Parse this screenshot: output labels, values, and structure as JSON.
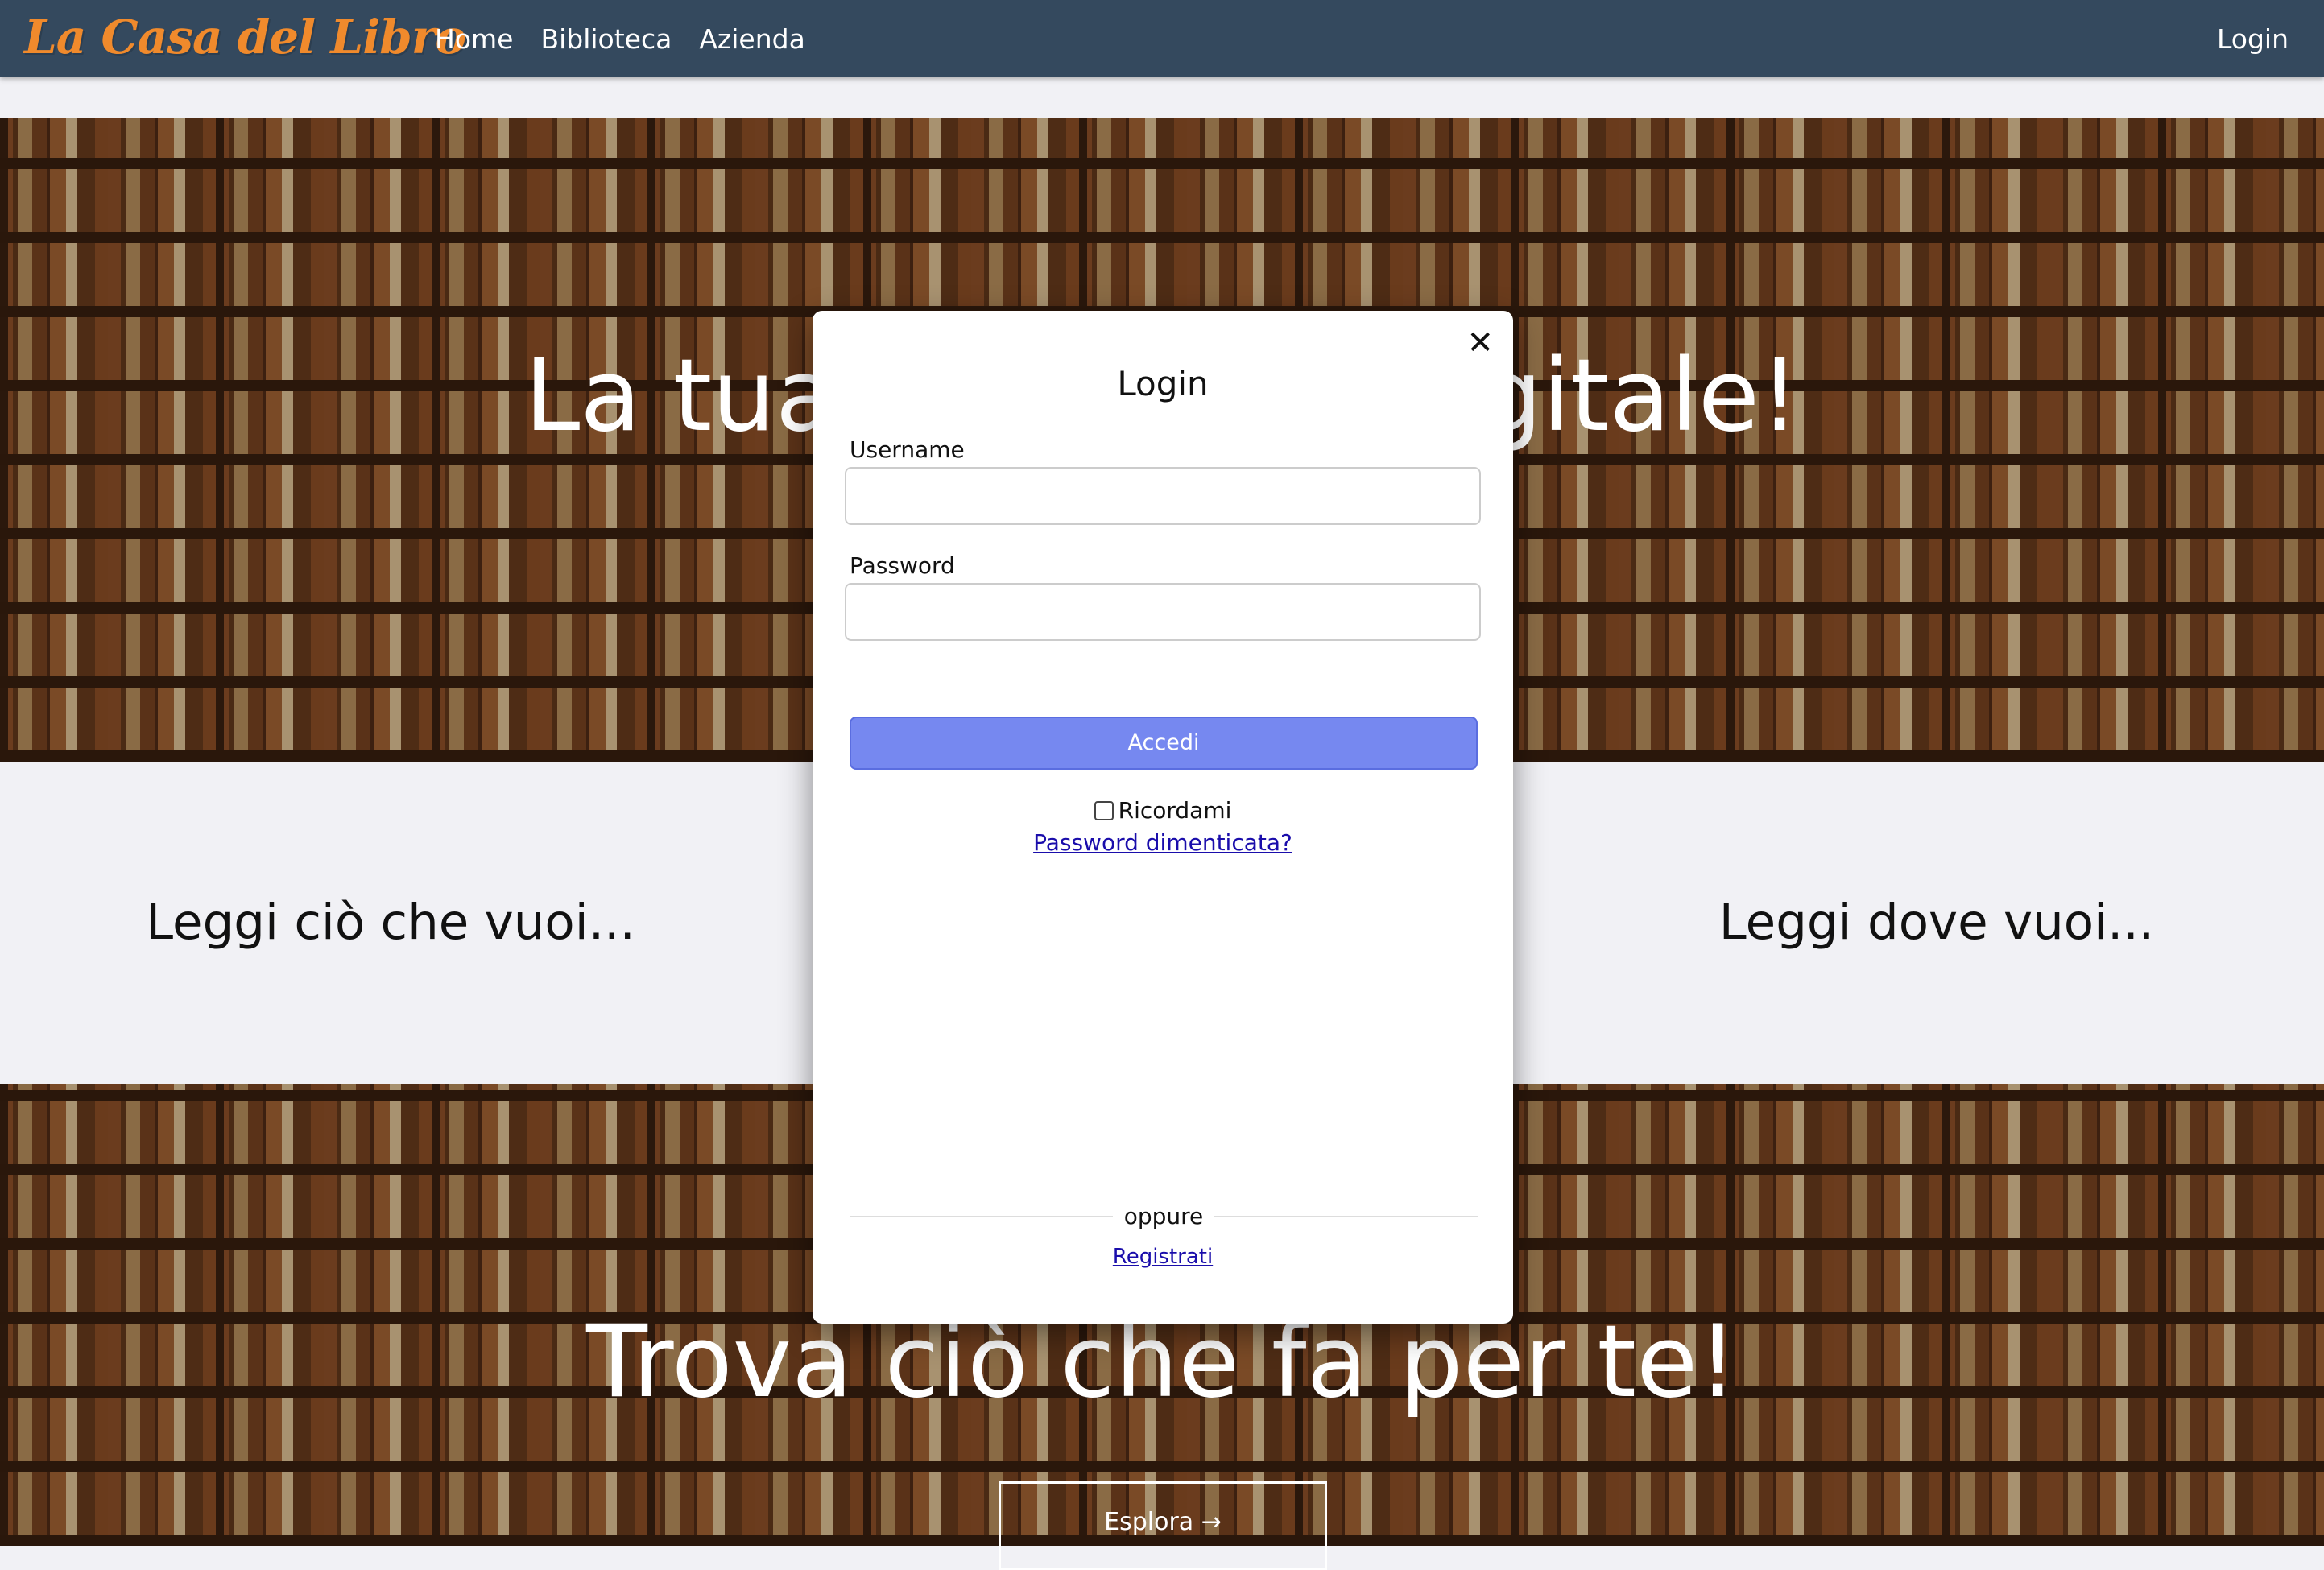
{
  "navbar": {
    "brand": "La Casa del Libro",
    "links": [
      "Home",
      "Biblioteca",
      "Azienda"
    ],
    "login": "Login"
  },
  "hero": {
    "title": "La tua biblioteca digitale!",
    "feature_left": "Leggi ciò che vuoi...",
    "feature_right": "Leggi dove vuoi...",
    "title_2": "Trova ciò che fa per te!",
    "explore": "Esplora →"
  },
  "modal": {
    "title": "Login",
    "username_label": "Username",
    "username_value": "",
    "password_label": "Password",
    "password_value": "",
    "submit": "Accedi",
    "remember": "Ricordami",
    "forgot": "Password dimenticata?",
    "divider": "oppure",
    "register": "Registrati",
    "close": "✕"
  },
  "colors": {
    "navbar_bg": "#34495e",
    "brand": "#f08a2c",
    "primary_button": "#7688f0",
    "link": "#1a0dab"
  }
}
